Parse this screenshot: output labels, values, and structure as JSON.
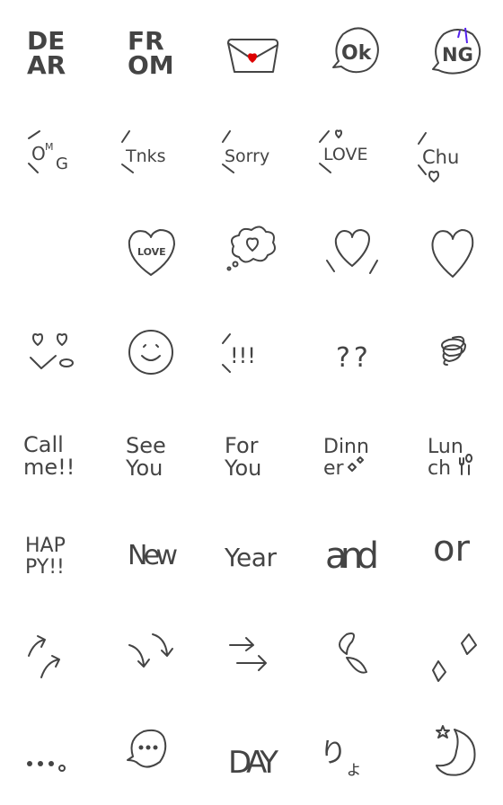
{
  "stickers": {
    "dear": [
      "DE",
      "AR"
    ],
    "from": [
      "FR",
      "OM"
    ],
    "ok": "Ok",
    "ng": "NG",
    "omg": [
      "O",
      "M",
      "G"
    ],
    "tnks": "Tnks",
    "sorry": "Sorry",
    "love": "LOVE",
    "chu": "Chu",
    "love_heart": "LOVE",
    "exclaim": "!!!",
    "question": "??",
    "call_me": [
      "Call",
      "me!!"
    ],
    "see_you": [
      "See",
      "You"
    ],
    "for_you": [
      "For",
      "You"
    ],
    "dinner": [
      "Dinn",
      "er"
    ],
    "lunch": [
      "Lun",
      "ch"
    ],
    "happy": [
      "HAP",
      "PY!!"
    ],
    "new": "New",
    "year": "Year",
    "and": "and",
    "or": "or",
    "day": "DAY",
    "ryo": [
      "り",
      "ょ"
    ]
  },
  "colors": {
    "ink": "#444444",
    "heart_red": "#dd0000",
    "accent_purple": "#5522ee"
  }
}
